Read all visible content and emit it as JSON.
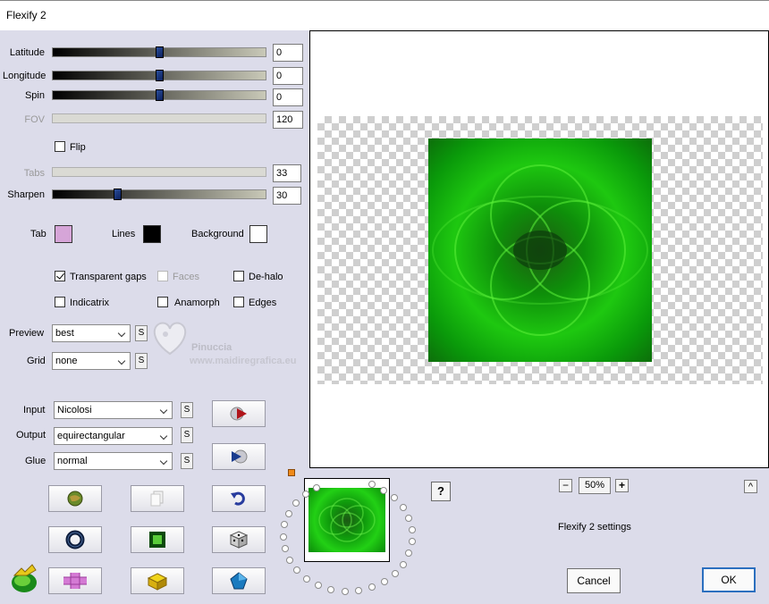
{
  "window": {
    "title": "Flexify 2"
  },
  "sliders": [
    {
      "label": "Latitude",
      "value": "0",
      "fraction": 0.5,
      "enabled": true
    },
    {
      "label": "Longitude",
      "value": "0",
      "fraction": 0.5,
      "enabled": true
    },
    {
      "label": "Spin",
      "value": "0",
      "fraction": 0.5,
      "enabled": true
    },
    {
      "label": "FOV",
      "value": "120",
      "fraction": 0.0,
      "enabled": false
    }
  ],
  "flip": {
    "label": "Flip",
    "checked": false
  },
  "tabs_slider": {
    "label": "Tabs",
    "value": "33",
    "enabled": false
  },
  "sharpen_slider": {
    "label": "Sharpen",
    "value": "30",
    "fraction": 0.3
  },
  "colors": {
    "tab_label": "Tab",
    "tab_color": "#d6a5d8",
    "lines_label": "Lines",
    "lines_color": "#000000",
    "background_label": "Background",
    "background_color": "#ffffff"
  },
  "options": {
    "transparent_gaps": {
      "label": "Transparent gaps",
      "checked": true
    },
    "faces": {
      "label": "Faces",
      "checked": false,
      "enabled": false
    },
    "dehalo": {
      "label": "De-halo",
      "checked": false
    },
    "indicatrix": {
      "label": "Indicatrix",
      "checked": false
    },
    "anamorph": {
      "label": "Anamorph",
      "checked": false
    },
    "edges": {
      "label": "Edges",
      "checked": false
    }
  },
  "preview": {
    "label": "Preview",
    "value": "best",
    "s": "S"
  },
  "grid": {
    "label": "Grid",
    "value": "none",
    "s": "S"
  },
  "input": {
    "label": "Input",
    "value": "Nicolosi",
    "s": "S"
  },
  "output": {
    "label": "Output",
    "value": "equirectangular",
    "s": "S"
  },
  "glue": {
    "label": "Glue",
    "value": "normal",
    "s": "S"
  },
  "watermark": {
    "line1": "Pinuccia",
    "line2": "www.maidiregrafica.eu"
  },
  "zoom": {
    "value": "50%",
    "minus": "−",
    "plus": "+"
  },
  "help": "?",
  "expand": "^",
  "settings_text": "Flexify 2 settings",
  "buttons": {
    "cancel": "Cancel",
    "ok": "OK"
  },
  "accent": "#2b6fbf"
}
